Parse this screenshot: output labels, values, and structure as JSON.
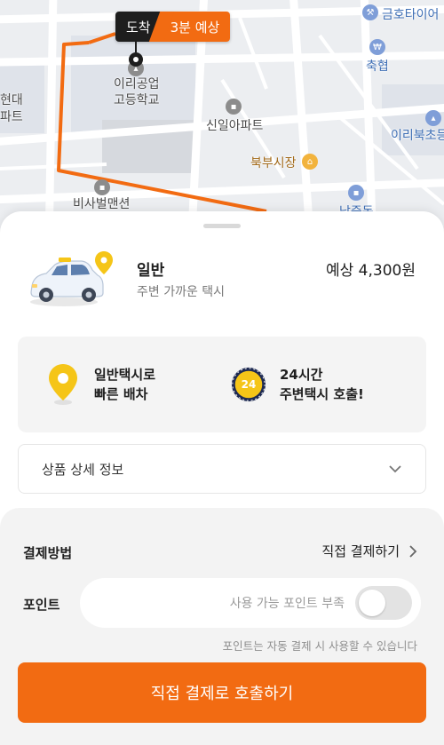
{
  "map": {
    "eta_arrive": "도착",
    "eta_time": "3분 예상",
    "labels": {
      "tire_shop": "금호타이어",
      "school_line1": "이리공업",
      "school_line2": "고등학교",
      "bank": "축협",
      "apartment": "신일아파트",
      "market": "북부시장",
      "mansion": "비사벌맨션",
      "elementary": "이리북초등",
      "district": "남중동",
      "left_partial_1": "현대",
      "left_partial_2": "파트"
    },
    "colors": {
      "route": "#f26b12"
    }
  },
  "product": {
    "title": "일반",
    "subtitle": "주변 가까운 택시",
    "price": "예상 4,300원"
  },
  "features": [
    {
      "line1": "일반택시로",
      "line2": "빠른 배차",
      "icon": "location-pin-icon"
    },
    {
      "line1": "24시간",
      "line2": "주변택시 호출!",
      "icon": "24-hour-icon",
      "icon_text": "24"
    }
  ],
  "detail": {
    "label": "상품 상세 정보"
  },
  "payment": {
    "label": "결제방법",
    "method": "직접 결제하기",
    "point_label": "포인트",
    "point_placeholder": "사용 가능 포인트 부족",
    "point_toggle_on": false,
    "point_note": "포인트는 자동 결제 시 사용할 수 있습니다"
  },
  "call_button": {
    "label": "직접 결제로 호출하기"
  },
  "colors": {
    "accent": "#f26b12",
    "pin": "#f5c518",
    "dark": "#1e1e1e"
  }
}
